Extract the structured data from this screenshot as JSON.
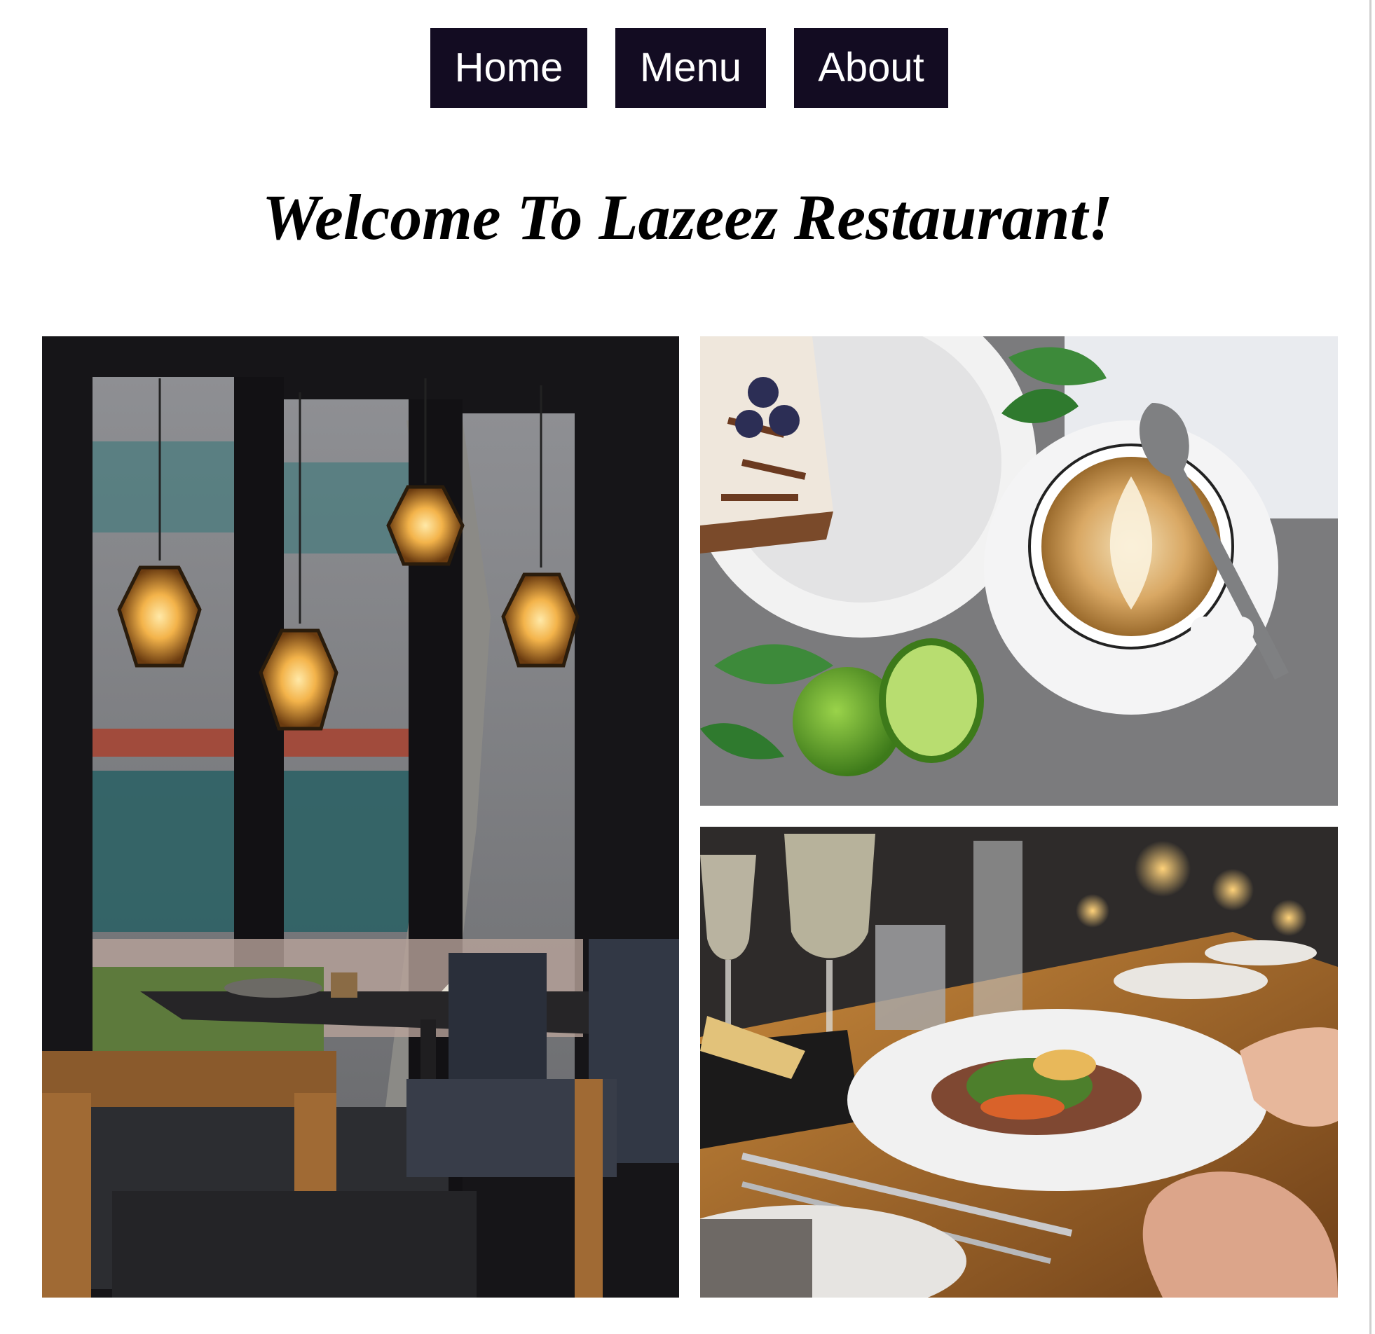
{
  "nav": {
    "items": [
      {
        "label": "Home"
      },
      {
        "label": "Menu"
      },
      {
        "label": "About"
      }
    ]
  },
  "hero": {
    "title": "Welcome To Lazeez Restaurant!"
  },
  "gallery": {
    "images": [
      {
        "subject": "restaurant-interior-with-pendant-lamps"
      },
      {
        "subject": "cake-and-latte-with-lime"
      },
      {
        "subject": "dining-table-with-plated-dish-and-wine-glasses"
      }
    ]
  },
  "colors": {
    "nav_background": "#130c22",
    "nav_text": "#ffffff",
    "title_text": "#000000",
    "page_background": "#ffffff"
  }
}
